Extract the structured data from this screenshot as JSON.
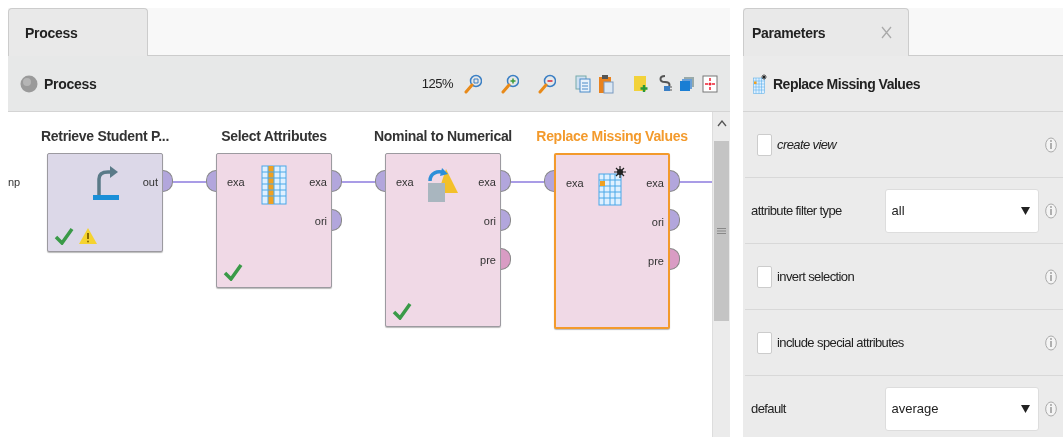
{
  "process_panel": {
    "tab": "Process",
    "toolbar": {
      "title": "Process",
      "zoom": "125%"
    },
    "canvas": {
      "left_port_label": "np",
      "operators": [
        {
          "name": "Retrieve  Student P...",
          "kind": "retrieve",
          "selected": false,
          "outputs": [
            {
              "label": "out",
              "kind": "data"
            }
          ],
          "valid": true,
          "warning": true
        },
        {
          "name": "Select Attributes",
          "kind": "select",
          "selected": false,
          "inputs": [
            {
              "label": "exa",
              "kind": "data"
            }
          ],
          "outputs": [
            {
              "label": "exa",
              "kind": "data"
            },
            {
              "label": "ori",
              "kind": "data"
            }
          ],
          "valid": true,
          "warning": false
        },
        {
          "name": "Nominal to Numerical",
          "kind": "convert",
          "selected": false,
          "inputs": [
            {
              "label": "exa",
              "kind": "data"
            }
          ],
          "outputs": [
            {
              "label": "exa",
              "kind": "data"
            },
            {
              "label": "ori",
              "kind": "data"
            },
            {
              "label": "pre",
              "kind": "model"
            }
          ],
          "valid": true,
          "warning": false
        },
        {
          "name": "Replace Missing Values",
          "kind": "replace",
          "selected": true,
          "inputs": [
            {
              "label": "exa",
              "kind": "data"
            }
          ],
          "outputs": [
            {
              "label": "exa",
              "kind": "data"
            },
            {
              "label": "ori",
              "kind": "data"
            },
            {
              "label": "pre",
              "kind": "model"
            }
          ],
          "valid": false,
          "warning": false
        }
      ]
    }
  },
  "parameters_panel": {
    "tab": "Parameters",
    "operator": "Replace Missing Values",
    "parameters": [
      {
        "kind": "checkbox",
        "label": "create view",
        "checked": false,
        "italic": true
      },
      {
        "kind": "select",
        "label": "attribute filter type",
        "value": "all"
      },
      {
        "kind": "checkbox",
        "label": "invert selection",
        "checked": false,
        "italic": false
      },
      {
        "kind": "checkbox",
        "label": "include special attributes",
        "checked": false,
        "italic": false
      },
      {
        "kind": "select",
        "label": "default",
        "value": "average"
      }
    ]
  }
}
